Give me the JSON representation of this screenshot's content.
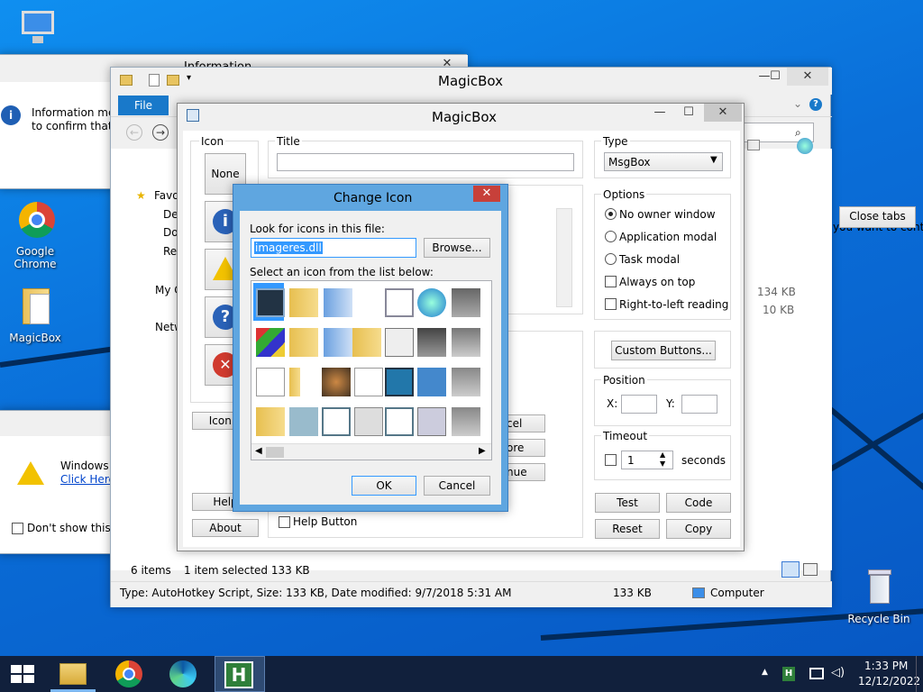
{
  "desktop": {
    "icons": [
      {
        "label": "",
        "icon": "this-pc-icon"
      },
      {
        "label": "Google Chrome",
        "icon": "chrome-icon"
      },
      {
        "label": "MagicBox",
        "icon": "folder-icon"
      },
      {
        "label": "Recycle Bin",
        "icon": "recycle-bin-icon"
      }
    ]
  },
  "bg_info_window": {
    "title_partial": "Information",
    "message_line1": "Information mes",
    "message_line2": "to confirm that t"
  },
  "bg_windows_window": {
    "title_partial": "Windows X",
    "link": "Click Here",
    "checkbox_label": "Don't show this m"
  },
  "explorer": {
    "title": "MagicBox",
    "file_tab": "File",
    "nav_items": [
      "Favo",
      "De",
      "Do",
      "Re",
      "My C",
      "Netw"
    ],
    "right_text": "you want to contin",
    "close_tabs": "Close tabs",
    "sizes": [
      "134 KB",
      "10 KB"
    ],
    "status_items": "6 items",
    "status_selected": "1 item selected  133 KB",
    "details_bar": "Type: AutoHotkey Script, Size: 133 KB, Date modified: 9/7/2018 5:31 AM",
    "details_size": "133 KB",
    "details_location": "Computer"
  },
  "magicbox": {
    "title": "MagicBox",
    "icon_group": "Icon",
    "none_label": "None",
    "icon_btn": "Icon...",
    "help_btn": "Help",
    "about_btn": "About",
    "title_label": "Title",
    "title_value": "",
    "type_label": "Type",
    "type_value": "MsgBox",
    "options_label": "Options",
    "options": [
      "No owner window",
      "Application modal",
      "Task modal"
    ],
    "checks": [
      "Always on top",
      "Right-to-left reading"
    ],
    "custom_buttons": "Custom Buttons...",
    "position_label": "Position",
    "x_label": "X:",
    "y_label": "Y:",
    "timeout_label": "Timeout",
    "timeout_value": "1",
    "seconds_label": "seconds",
    "test_btn": "Test",
    "code_btn": "Code",
    "reset_btn": "Reset",
    "copy_btn": "Copy",
    "help_button_label": "Help Button",
    "partial_btns": [
      "cel",
      "ore",
      "nue"
    ]
  },
  "change_icon": {
    "title": "Change Icon",
    "look_label": "Look for icons in this file:",
    "file_value": "imageres.dll",
    "browse": "Browse...",
    "select_label": "Select an icon from the list below:",
    "ok": "OK",
    "cancel": "Cancel"
  },
  "taskbar": {
    "time": "1:33 PM",
    "date": "12/12/2022"
  },
  "colors": {
    "accent": "#1979ca",
    "desktop": "#0a6fd6",
    "dialog_frame": "#5fa6e0",
    "close_red": "#c7403a",
    "selection": "#3399ff"
  }
}
